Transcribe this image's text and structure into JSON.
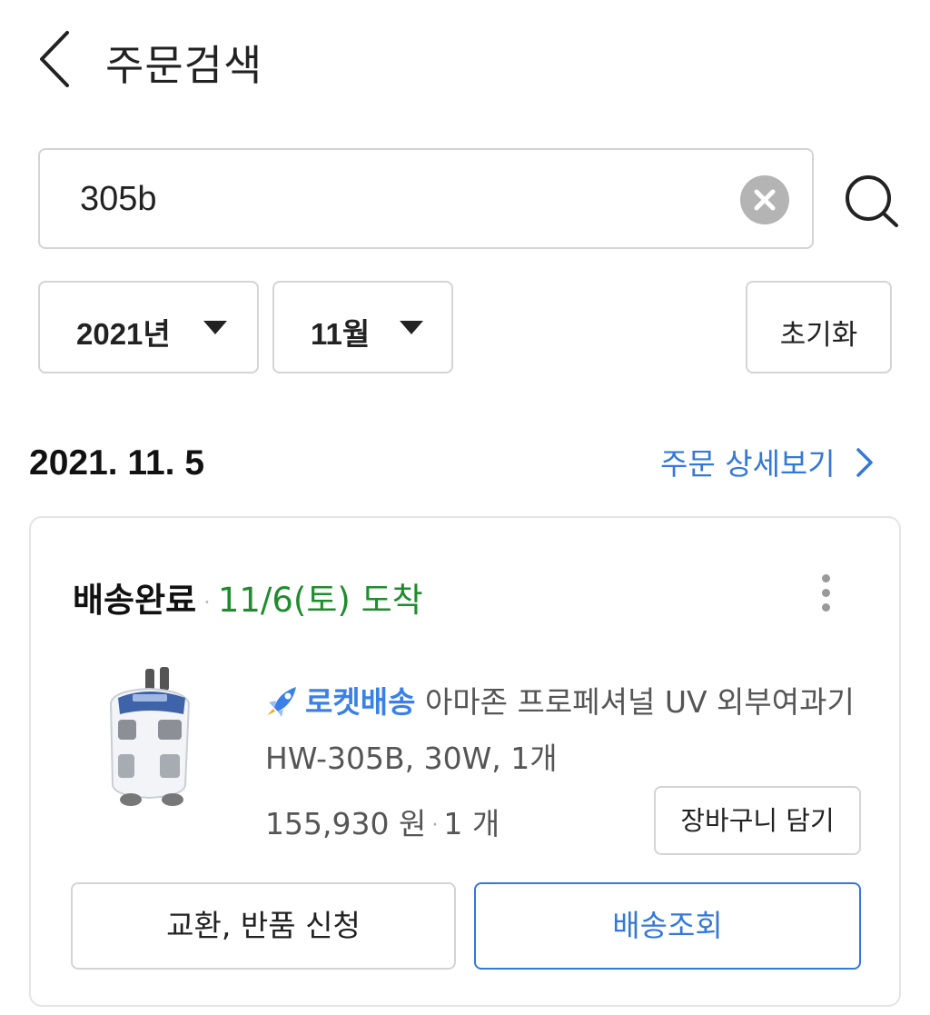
{
  "header": {
    "title": "주문검색",
    "back_icon": "chevron-left-icon"
  },
  "search": {
    "value": "305b",
    "clear_icon": "clear-circle-icon",
    "search_icon": "search-icon"
  },
  "filters": {
    "year": "2021년",
    "month": "11월",
    "reset_label": "초기화"
  },
  "order": {
    "date": "2021. 11. 5",
    "detail_link": "주문 상세보기",
    "status": "배송완료",
    "separator": "·",
    "arrival": "11/6(토) 도착",
    "badge": "로켓배송",
    "product_name": "아마존 프로페셔널 UV 외부여과기 HW-305B, 30W, 1개",
    "price": "155,930 원",
    "quantity": "1 개",
    "cart_button": "장바구니 담기",
    "return_button": "교환, 반품 신청",
    "track_button": "배송조회"
  },
  "colors": {
    "accent_blue": "#3478d8",
    "arrival_green": "#1f8c2e",
    "border_gray": "#d4d4d4"
  }
}
